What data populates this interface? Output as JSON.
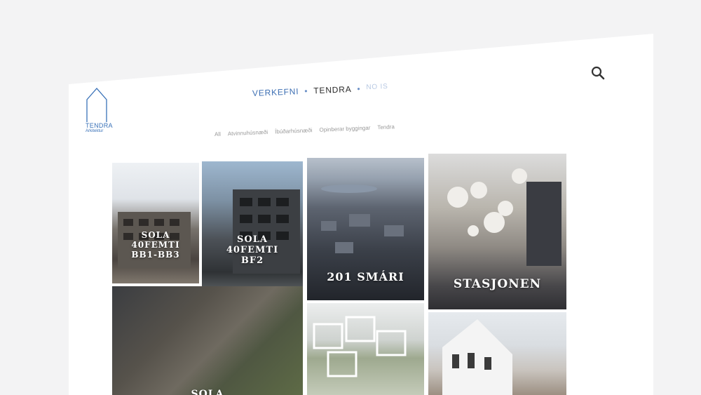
{
  "brand": {
    "name": "TENDRA",
    "sub": "Arkitektur"
  },
  "nav": {
    "items": [
      "VERKEFNI",
      "TENDRA",
      "NO IS"
    ],
    "separator": "•"
  },
  "filters": [
    "All",
    "Atvinnuhúsnæði",
    "Íbúðarhúsnæði",
    "Opinberar byggingar",
    "Tendra"
  ],
  "projects": [
    {
      "title": "SOLA\n40FEMTI\nBB1-BB3"
    },
    {
      "title": "SOLA\n40FEMTI\nBF2"
    },
    {
      "title": "201 SMÁRI"
    },
    {
      "title": "STASJONEN"
    },
    {
      "title": "SOLA"
    },
    {
      "title": ""
    },
    {
      "title": ""
    }
  ],
  "colors": {
    "accent": "#3d6fb3",
    "dim": "#b8c9e3",
    "background": "#ffffff"
  },
  "icons": {
    "search": "search-icon",
    "logo": "house-outline-logo"
  }
}
